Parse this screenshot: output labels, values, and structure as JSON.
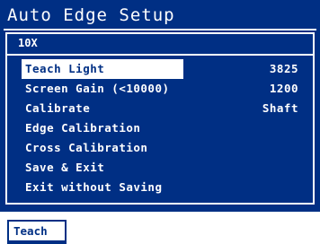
{
  "title": "Auto Edge Setup",
  "zoom": "10X",
  "menu": {
    "items": [
      {
        "label": "Teach Light",
        "value": "3825"
      },
      {
        "label": "Screen Gain (<10000)",
        "value": "1200"
      },
      {
        "label": "Calibrate",
        "value": "Shaft"
      },
      {
        "label": "Edge Calibration",
        "value": ""
      },
      {
        "label": "Cross Calibration",
        "value": ""
      },
      {
        "label": "Save & Exit",
        "value": ""
      },
      {
        "label": "Exit without Saving",
        "value": ""
      }
    ]
  },
  "softkeys": {
    "teach_label": "Teach"
  },
  "colors": {
    "panel_background": "#002f84",
    "text": "#ffffff",
    "selection_background": "#ffffff",
    "selection_text": "#002f84"
  }
}
